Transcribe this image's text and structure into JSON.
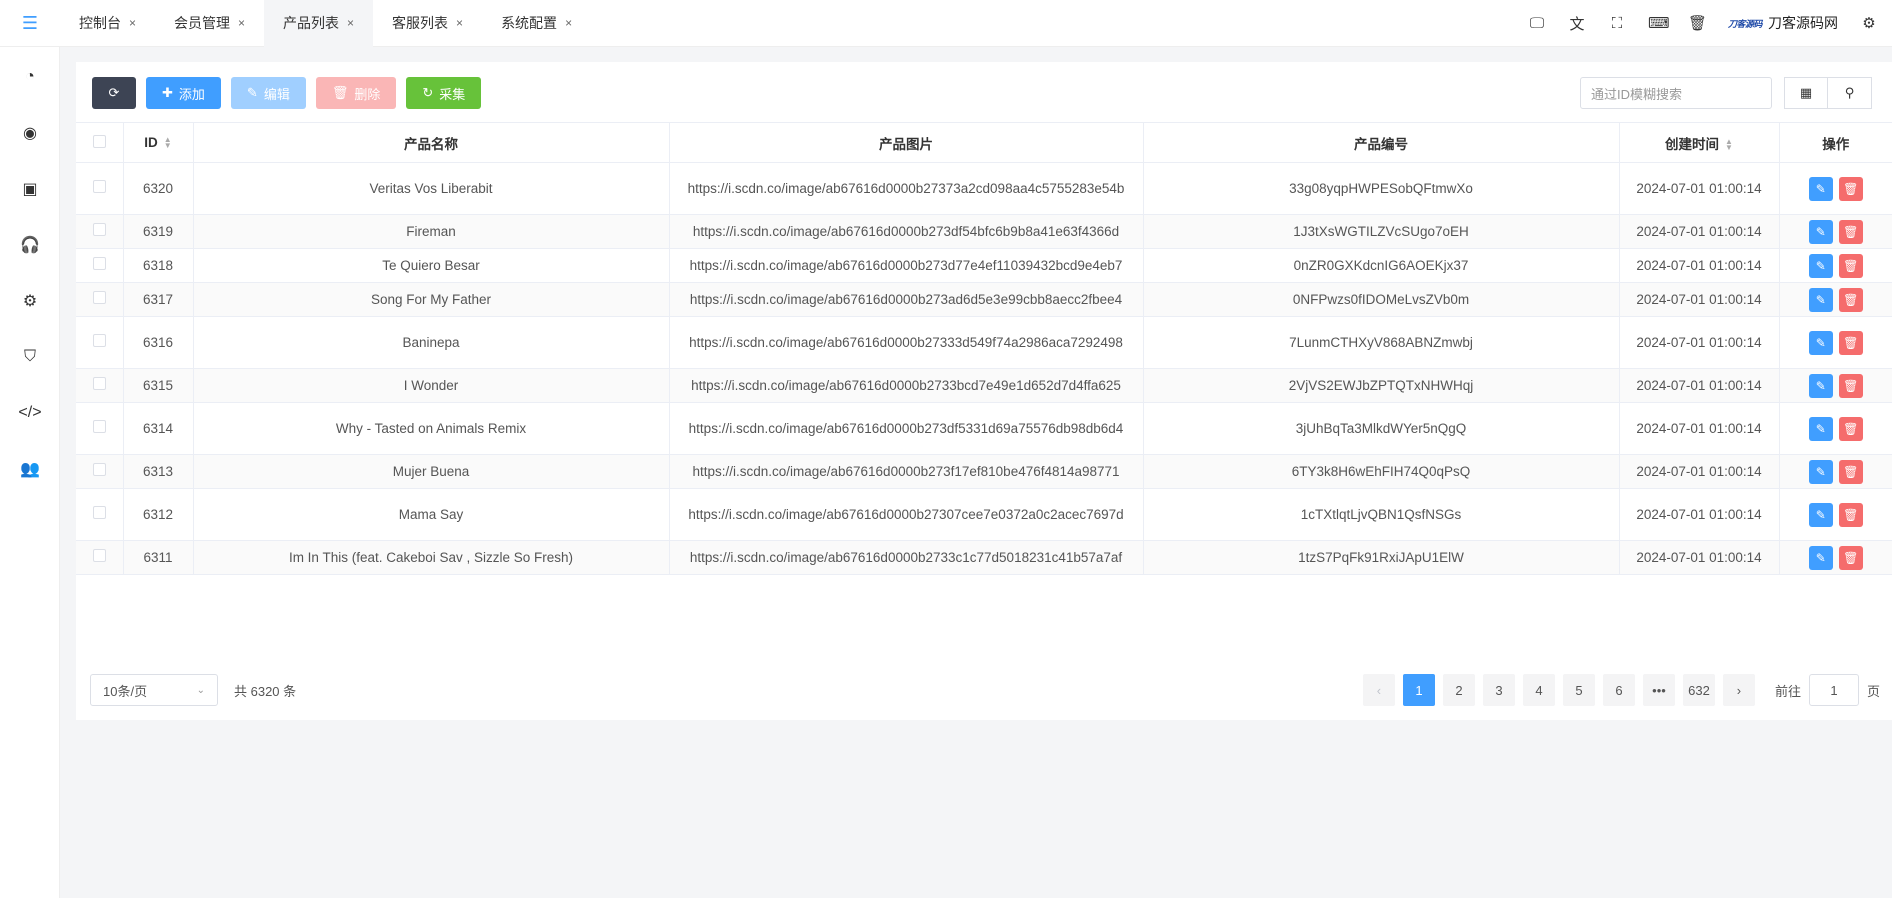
{
  "tabs": [
    {
      "label": "控制台"
    },
    {
      "label": "会员管理"
    },
    {
      "label": "产品列表"
    },
    {
      "label": "客服列表"
    },
    {
      "label": "系统配置"
    }
  ],
  "tab_close": "×",
  "brand": {
    "mark": "刀客源码",
    "name": "刀客源码网"
  },
  "toolbar": {
    "add_label": "添加",
    "edit_label": "编辑",
    "delete_label": "删除",
    "collect_label": "采集",
    "search_placeholder": "通过ID模糊搜索"
  },
  "columns": {
    "id": "ID",
    "name": "产品名称",
    "image": "产品图片",
    "code": "产品编号",
    "created": "创建时间",
    "actions": "操作"
  },
  "rows": [
    {
      "id": "6320",
      "name": "Veritas Vos Liberabit",
      "image": "https://i.scdn.co/image/ab67616d0000b27373a2cd098aa4c5755283e54b",
      "code": "33g08yqpHWPESobQFtmwXo",
      "created": "2024-07-01 01:00:14"
    },
    {
      "id": "6319",
      "name": "Fireman",
      "image": "https://i.scdn.co/image/ab67616d0000b273df54bfc6b9b8a41e63f4366d",
      "code": "1J3tXsWGTILZVcSUgo7oEH",
      "created": "2024-07-01 01:00:14"
    },
    {
      "id": "6318",
      "name": "Te Quiero Besar",
      "image": "https://i.scdn.co/image/ab67616d0000b273d77e4ef11039432bcd9e4eb7",
      "code": "0nZR0GXKdcnIG6AOEKjx37",
      "created": "2024-07-01 01:00:14"
    },
    {
      "id": "6317",
      "name": "Song For My Father",
      "image": "https://i.scdn.co/image/ab67616d0000b273ad6d5e3e99cbb8aecc2fbee4",
      "code": "0NFPwzs0fIDOMeLvsZVb0m",
      "created": "2024-07-01 01:00:14"
    },
    {
      "id": "6316",
      "name": "Baninepa",
      "image": "https://i.scdn.co/image/ab67616d0000b27333d549f74a2986aca7292498",
      "code": "7LunmCTHXyV868ABNZmwbj",
      "created": "2024-07-01 01:00:14"
    },
    {
      "id": "6315",
      "name": "I Wonder",
      "image": "https://i.scdn.co/image/ab67616d0000b2733bcd7e49e1d652d7d4ffa625",
      "code": "2VjVS2EWJbZPTQTxNHWHqj",
      "created": "2024-07-01 01:00:14"
    },
    {
      "id": "6314",
      "name": "Why - Tasted on Animals Remix",
      "image": "https://i.scdn.co/image/ab67616d0000b273df5331d69a75576db98db6d4",
      "code": "3jUhBqTa3MlkdWYer5nQgQ",
      "created": "2024-07-01 01:00:14"
    },
    {
      "id": "6313",
      "name": "Mujer Buena",
      "image": "https://i.scdn.co/image/ab67616d0000b273f17ef810be476f4814a98771",
      "code": "6TY3k8H6wEhFIH74Q0qPsQ",
      "created": "2024-07-01 01:00:14"
    },
    {
      "id": "6312",
      "name": "Mama Say",
      "image": "https://i.scdn.co/image/ab67616d0000b27307cee7e0372a0c2acec7697d",
      "code": "1cTXtlqtLjvQBN1QsfNSGs",
      "created": "2024-07-01 01:00:14"
    },
    {
      "id": "6311",
      "name": "Im In This (feat. Cakeboi Sav , Sizzle So Fresh)",
      "image": "https://i.scdn.co/image/ab67616d0000b2733c1c77d5018231c41b57a7af",
      "code": "1tzS7PqFk91RxiJApU1ElW",
      "created": "2024-07-01 01:00:14"
    }
  ],
  "pagination": {
    "page_size": "10条/页",
    "total": "共 6320 条",
    "pages": [
      "1",
      "2",
      "3",
      "4",
      "5",
      "6"
    ],
    "ellipsis": "•••",
    "last_page": "632",
    "prev": "‹",
    "next": "›",
    "goto_prefix": "前往",
    "goto_value": "1",
    "goto_suffix": "页"
  },
  "colors": {
    "primary": "#409eff",
    "success": "#67c23a",
    "danger": "#f56c6c",
    "dark": "#3d4454"
  }
}
